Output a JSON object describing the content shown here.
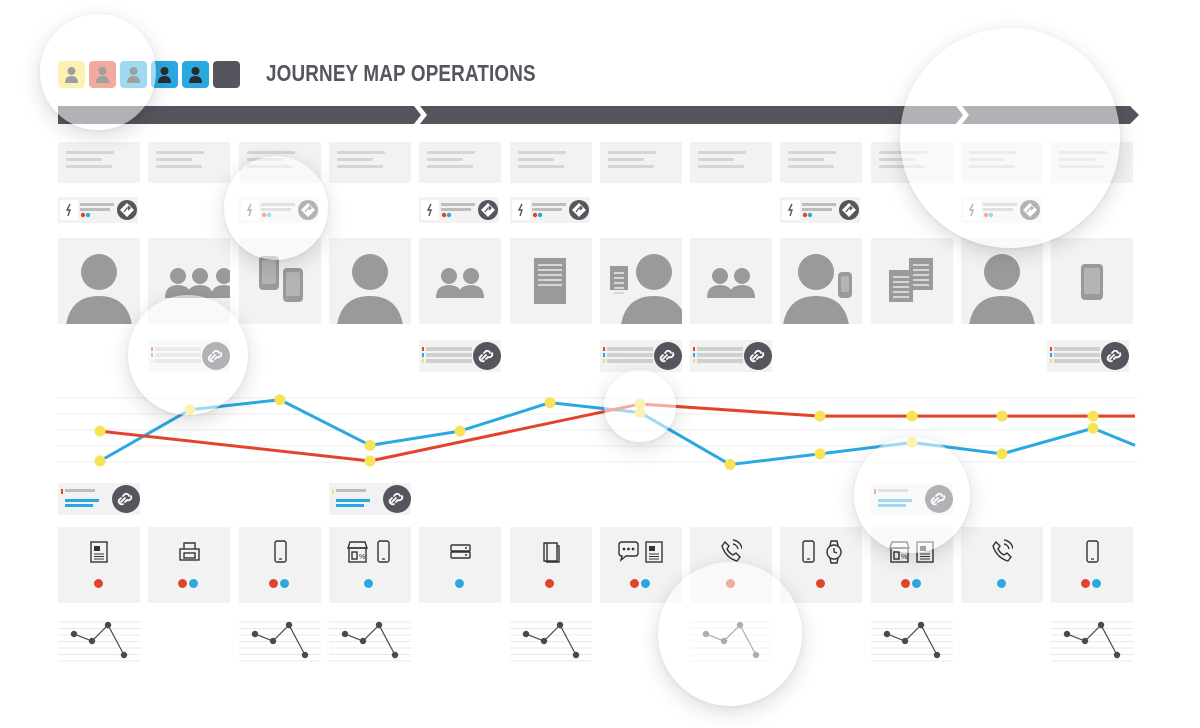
{
  "header": {
    "title": "JOURNEY MAP OPERATIONS",
    "personas": [
      {
        "name": "persona-yellow",
        "color": "#f6e356",
        "icon": "user-icon"
      },
      {
        "name": "persona-red",
        "color": "#e2442a",
        "icon": "user-icon"
      },
      {
        "name": "persona-blue-1",
        "color": "#29a9df",
        "icon": "user-icon"
      },
      {
        "name": "persona-blue-2",
        "color": "#29a9df",
        "icon": "user-icon"
      },
      {
        "name": "persona-blue-3",
        "color": "#29a9df",
        "icon": "user-icon"
      },
      {
        "name": "persona-add",
        "color": "#55555d",
        "icon": "none"
      }
    ]
  },
  "colors": {
    "dark": "#55555d",
    "red": "#e2442a",
    "blue": "#29a9df",
    "yellow": "#f6e356",
    "cell": "#f2f2f2",
    "placeholder": "#d5d5d5"
  },
  "stage_bar": {
    "segments": 3
  },
  "columns": 12,
  "insights_row": {
    "columns": [
      0,
      2,
      4,
      5,
      8,
      10
    ]
  },
  "illustrations": [
    "person-icon",
    "people-group-icon",
    "devices-icon",
    "person-icon",
    "people-group-icon",
    "document-icon",
    "person-document-icon",
    "people-group-icon",
    "person-phone-icon",
    "documents-icon",
    "person-icon",
    "mobile-device-icon"
  ],
  "link_cards_upper": {
    "columns": [
      1,
      4,
      6,
      7,
      11
    ]
  },
  "link_cards_lower": {
    "columns": [
      0,
      3,
      9
    ]
  },
  "touchpoints": [
    {
      "icons": [
        "newspaper-icon"
      ],
      "dots": [
        "red"
      ]
    },
    {
      "icons": [
        "printer-icon"
      ],
      "dots": [
        "red",
        "blue"
      ]
    },
    {
      "icons": [
        "mobile-phone-icon"
      ],
      "dots": [
        "red",
        "blue"
      ]
    },
    {
      "icons": [
        "store-icon",
        "mobile-phone-icon"
      ],
      "dots": [
        "blue"
      ]
    },
    {
      "icons": [
        "server-icon"
      ],
      "dots": [
        "blue"
      ]
    },
    {
      "icons": [
        "book-icon"
      ],
      "dots": [
        "red"
      ]
    },
    {
      "icons": [
        "chat-icon",
        "newspaper-icon"
      ],
      "dots": [
        "red",
        "blue"
      ]
    },
    {
      "icons": [
        "phone-call-icon"
      ],
      "dots": [
        "red"
      ]
    },
    {
      "icons": [
        "mobile-phone-icon",
        "smartwatch-icon"
      ],
      "dots": [
        "red"
      ]
    },
    {
      "icons": [
        "store-icon",
        "newspaper-icon"
      ],
      "dots": [
        "red",
        "blue"
      ]
    },
    {
      "icons": [
        "phone-call-icon"
      ],
      "dots": [
        "blue"
      ]
    },
    {
      "icons": [
        "mobile-phone-icon"
      ],
      "dots": [
        "red",
        "blue"
      ]
    }
  ],
  "mini_charts": {
    "columns": [
      0,
      2,
      3,
      5,
      7,
      9,
      11
    ],
    "values": [
      0.35,
      0.6,
      0.0,
      0.95
    ]
  },
  "chart_data": {
    "type": "line",
    "x": [
      1,
      2,
      3,
      4,
      5,
      6,
      7,
      8,
      9,
      10,
      11,
      12
    ],
    "series": [
      {
        "color": "#29a9df",
        "values": [
          0.0,
          0.72,
          0.86,
          0.22,
          0.42,
          0.82,
          0.68,
          -0.05,
          0.1,
          0.26,
          0.1,
          0.46,
          0.22
        ]
      },
      {
        "color": "#e2442a",
        "values": [
          0.42,
          null,
          null,
          0.0,
          null,
          null,
          0.8,
          null,
          0.63,
          0.63,
          0.63,
          0.63,
          0.63
        ]
      }
    ],
    "marker_color": "#f6e356",
    "grid": true
  }
}
